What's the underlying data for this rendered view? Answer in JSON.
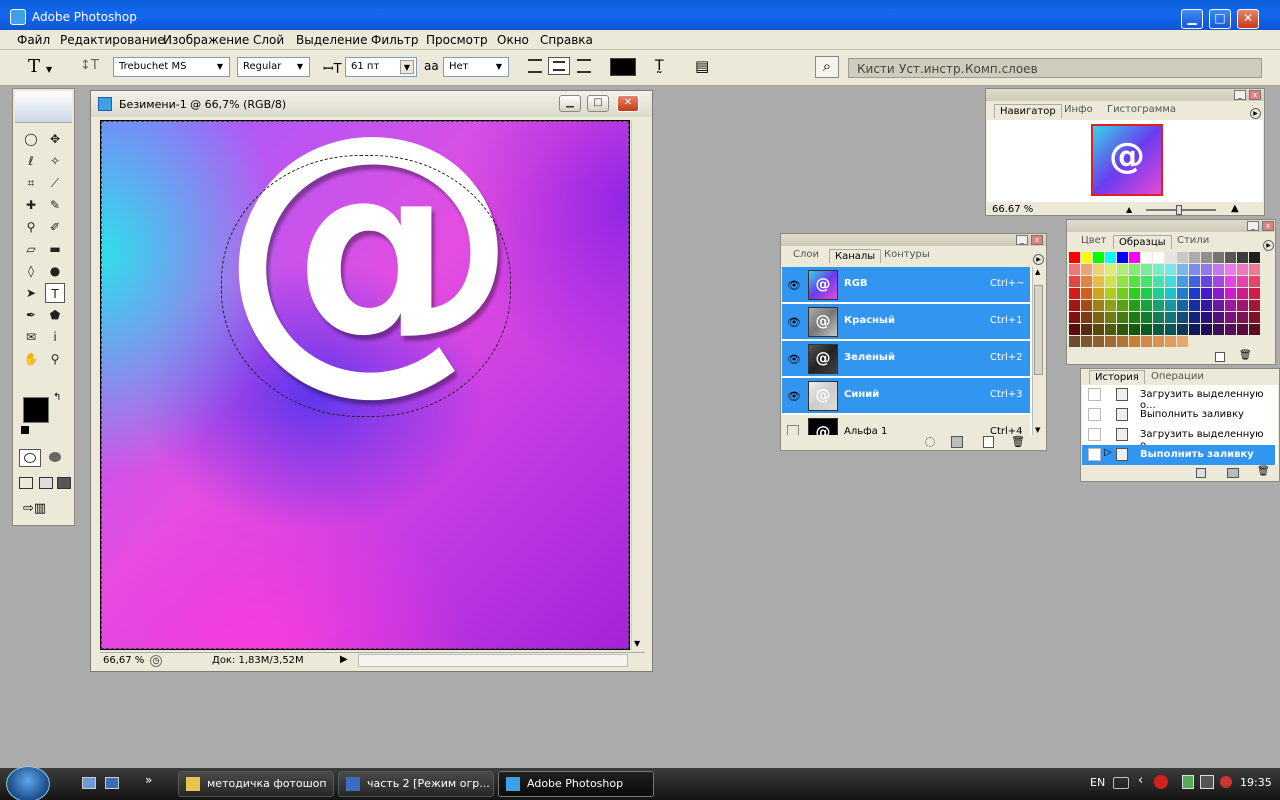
{
  "window": {
    "title": "Adobe Photoshop",
    "min_glyph": "▁",
    "max_glyph": "□",
    "close_glyph": "✕"
  },
  "menu": [
    "Файл",
    "Редактирование",
    "Изображение",
    "Слой",
    "Выделение",
    "Фильтр",
    "Просмотр",
    "Окно",
    "Справка"
  ],
  "options_bar": {
    "tool_glyph": "T",
    "orient_glyph": "↕T",
    "font_family": "Trebuchet MS",
    "font_style": "Regular",
    "font_size": "61 пт",
    "size_icon": "ꟷT",
    "aa_icon": "aa",
    "antialias": "Нет",
    "text_color": "#000000",
    "warp_glyph": "T̰",
    "palette_glyph": "▤",
    "file_browser_glyph": "⌕",
    "well_tabs": [
      "Кисти",
      "Уст.инстр.",
      "Комп.слоев"
    ]
  },
  "toolbox": {
    "tools": [
      {
        "name": "marquee",
        "glyph": "◯"
      },
      {
        "name": "move",
        "glyph": "✥"
      },
      {
        "name": "lasso",
        "glyph": "ℓ"
      },
      {
        "name": "magic-wand",
        "glyph": "✧"
      },
      {
        "name": "crop",
        "glyph": "⌗"
      },
      {
        "name": "slice",
        "glyph": "⟋"
      },
      {
        "name": "healing",
        "glyph": "✚"
      },
      {
        "name": "brush",
        "glyph": "✎"
      },
      {
        "name": "stamp",
        "glyph": "⚲"
      },
      {
        "name": "history-brush",
        "glyph": "✐"
      },
      {
        "name": "eraser",
        "glyph": "▱"
      },
      {
        "name": "gradient",
        "glyph": "▬"
      },
      {
        "name": "blur",
        "glyph": "◊"
      },
      {
        "name": "dodge",
        "glyph": "●"
      },
      {
        "name": "path-select",
        "glyph": "➤"
      },
      {
        "name": "type",
        "glyph": "T"
      },
      {
        "name": "pen",
        "glyph": "✒"
      },
      {
        "name": "shape",
        "glyph": "⬟"
      },
      {
        "name": "notes",
        "glyph": "✉"
      },
      {
        "name": "eyedropper",
        "glyph": "ⅰ"
      },
      {
        "name": "hand",
        "glyph": "✋"
      },
      {
        "name": "zoom",
        "glyph": "⚲"
      }
    ],
    "fg_color": "#000000",
    "bg_color": "#ffffff"
  },
  "document": {
    "title": "Безимени-1 @ 66,7% (RGB/8)",
    "zoom": "66,67 %",
    "doc_info": "Док: 1,83M/3,52M",
    "artwork_glyph": "@"
  },
  "navigator": {
    "tabs": [
      "Навигатор",
      "Инфо",
      "Гистограмма"
    ],
    "zoom": "66.67 %"
  },
  "channels": {
    "tabs": [
      "Слои",
      "Каналы",
      "Контуры"
    ],
    "rows": [
      {
        "name": "RGB",
        "shortcut": "Ctrl+~"
      },
      {
        "name": "Красный",
        "shortcut": "Ctrl+1"
      },
      {
        "name": "Зеленый",
        "shortcut": "Ctrl+2"
      },
      {
        "name": "Синий",
        "shortcut": "Ctrl+3"
      },
      {
        "name": "Альфа 1",
        "shortcut": "Ctrl+4"
      }
    ]
  },
  "swatches": {
    "tabs": [
      "Цвет",
      "Образцы",
      "Стили"
    ]
  },
  "history": {
    "tabs": [
      "История",
      "Операции"
    ],
    "rows": [
      "Загрузить выделенную о...",
      "Выполнить заливку",
      "Загрузить выделенную о...",
      "Выполнить заливку"
    ]
  },
  "taskbar": {
    "items": [
      "методичка фотошоп",
      "часть 2 [Режим огр...",
      "Adobe Photoshop"
    ],
    "lang": "EN",
    "clock": "19:35"
  }
}
